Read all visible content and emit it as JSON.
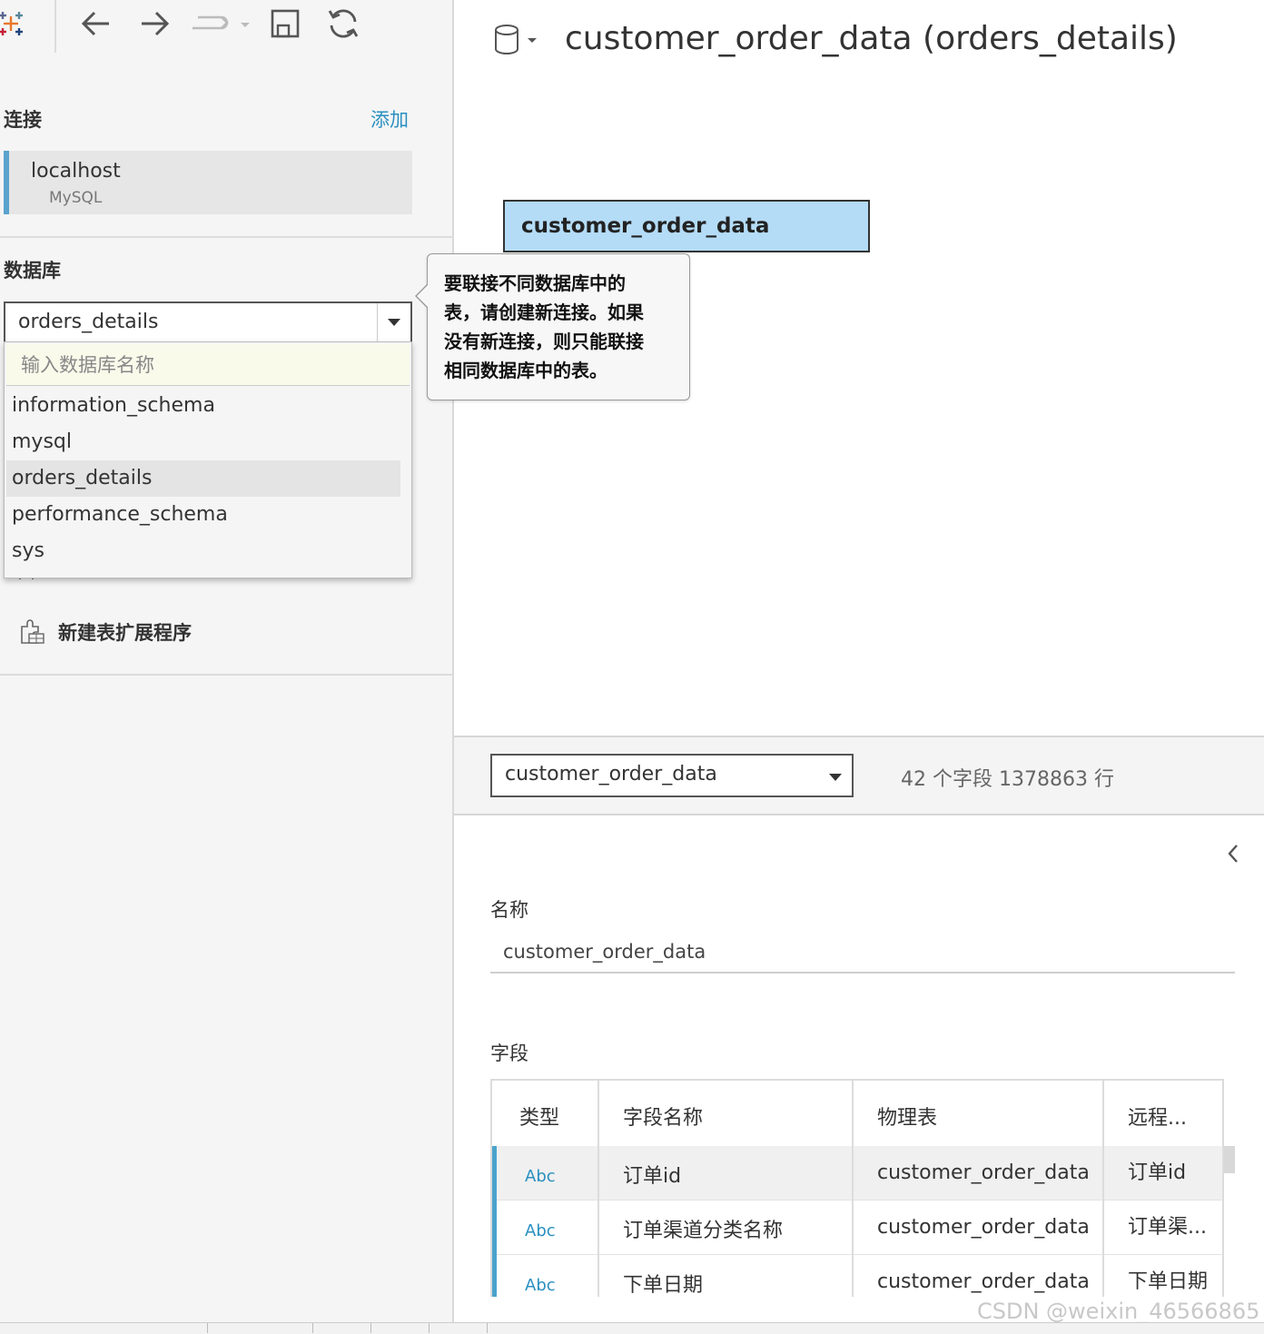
{
  "toolbar": {
    "icons": [
      "tableau-logo-icon",
      "back-arrow-icon",
      "forward-arrow-icon",
      "redo-icon",
      "save-icon",
      "refresh-icon"
    ]
  },
  "connections": {
    "title": "连接",
    "add_label": "添加",
    "items": [
      {
        "name": "localhost",
        "type": "MySQL"
      }
    ]
  },
  "database": {
    "title": "数据库",
    "selected": "orders_details",
    "search_placeholder": "输入数据库名称",
    "options": [
      "information_schema",
      "mysql",
      "orders_details",
      "performance_schema",
      "sys"
    ],
    "selected_index": 2
  },
  "sidebar": {
    "new_extension_label": "新建表扩展程序"
  },
  "tooltip": {
    "lines": [
      "要联接不同数据库中的",
      "表，请创建新连接。如果",
      "没有新连接，则只能联接",
      "相同数据库中的表。"
    ]
  },
  "datasource": {
    "title": "customer_order_data (orders_details)"
  },
  "canvas": {
    "table_node": "customer_order_data"
  },
  "metadata": {
    "table_select": "customer_order_data",
    "info": "42 个字段 1378863 行",
    "name_label": "名称",
    "name_value": "customer_order_data",
    "fields_label": "字段",
    "columns": [
      "类型",
      "字段名称",
      "物理表",
      "远程..."
    ],
    "rows": [
      {
        "type": "Abc",
        "field": "订单id",
        "table": "customer_order_data",
        "remote": "订单id"
      },
      {
        "type": "Abc",
        "field": "订单渠道分类名称",
        "table": "customer_order_data",
        "remote": "订单渠..."
      },
      {
        "type": "Abc",
        "field": "下单日期",
        "table": "customer_order_data",
        "remote": "下单日期"
      }
    ]
  },
  "watermark": "CSDN @weixin_46566865",
  "colors": {
    "accent": "#2a8fc0",
    "table_node_fill": "#b4dcf7",
    "tooltip_bg": "#f7f7f7",
    "search_bg": "#fafaeb"
  }
}
